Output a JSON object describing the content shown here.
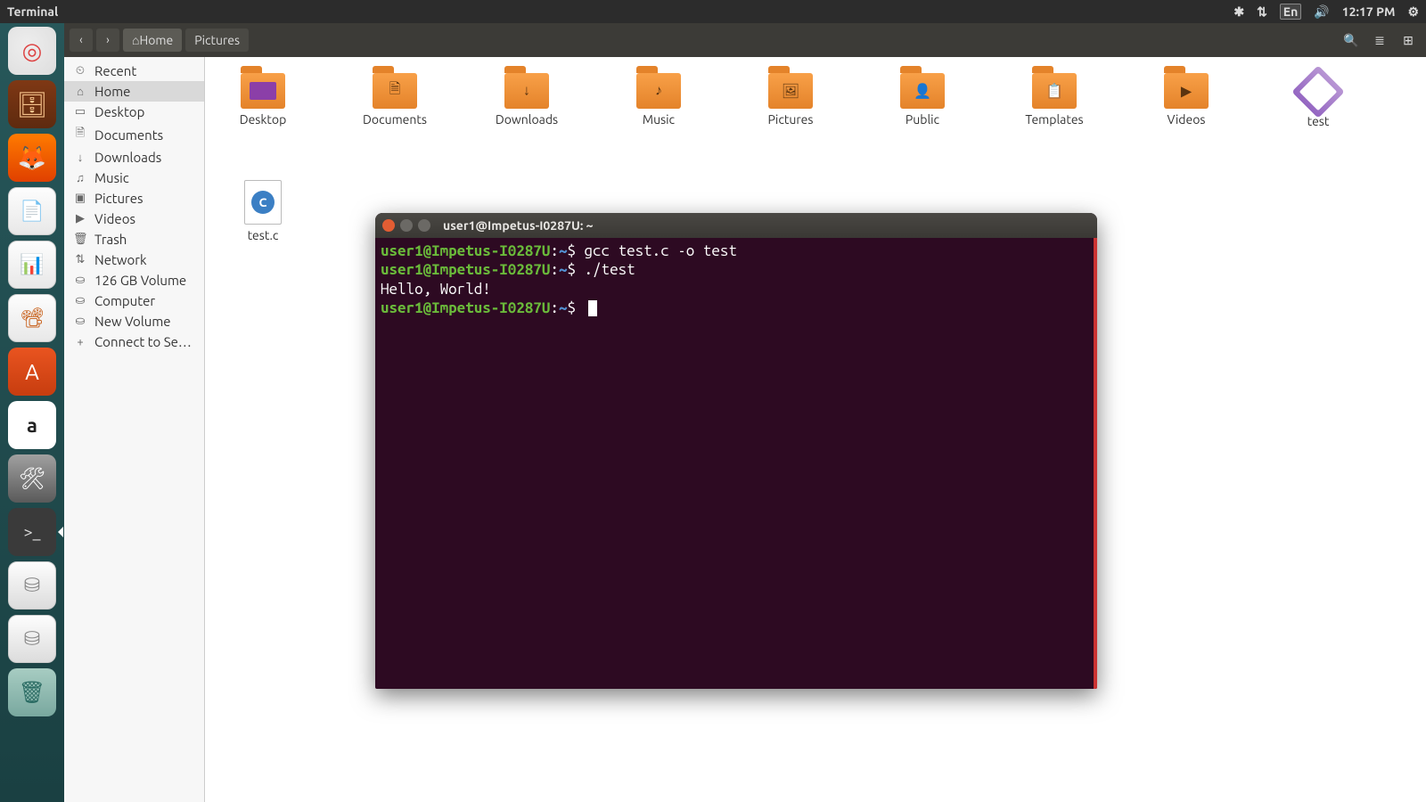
{
  "menubar": {
    "app_name": "Terminal",
    "lang_indicator": "En",
    "clock": "12:17 PM"
  },
  "launcher": [
    {
      "name": "dash",
      "tip": "Ubuntu Dash"
    },
    {
      "name": "files",
      "tip": "Files"
    },
    {
      "name": "firefox",
      "tip": "Firefox"
    },
    {
      "name": "writer",
      "tip": "LibreOffice Writer"
    },
    {
      "name": "calc",
      "tip": "LibreOffice Calc"
    },
    {
      "name": "impress",
      "tip": "LibreOffice Impress"
    },
    {
      "name": "software",
      "tip": "Ubuntu Software"
    },
    {
      "name": "amazon",
      "tip": "Amazon"
    },
    {
      "name": "settings",
      "tip": "System Settings"
    },
    {
      "name": "terminal",
      "tip": "Terminal"
    },
    {
      "name": "drive1",
      "tip": "Drive"
    },
    {
      "name": "drive2",
      "tip": "Drive"
    },
    {
      "name": "trash",
      "tip": "Trash"
    }
  ],
  "nautilus": {
    "path": [
      "Home",
      "Pictures"
    ],
    "sidebar": [
      {
        "icon": "⏲",
        "label": "Recent"
      },
      {
        "icon": "⌂",
        "label": "Home",
        "selected": true
      },
      {
        "icon": "▭",
        "label": "Desktop"
      },
      {
        "icon": "🗎",
        "label": "Documents"
      },
      {
        "icon": "↓",
        "label": "Downloads"
      },
      {
        "icon": "♫",
        "label": "Music"
      },
      {
        "icon": "▣",
        "label": "Pictures"
      },
      {
        "icon": "▶",
        "label": "Videos"
      },
      {
        "icon": "🗑",
        "label": "Trash"
      },
      {
        "icon": "⇅",
        "label": "Network"
      },
      {
        "icon": "⛀",
        "label": "126 GB Volume"
      },
      {
        "icon": "⛀",
        "label": "Computer"
      },
      {
        "icon": "⛀",
        "label": "New Volume"
      },
      {
        "icon": "+",
        "label": "Connect to Se…"
      }
    ],
    "files": [
      {
        "name": "Desktop",
        "type": "folder",
        "overlay": "desktop"
      },
      {
        "name": "Documents",
        "type": "folder",
        "overlay": "doc"
      },
      {
        "name": "Downloads",
        "type": "folder",
        "overlay": "down"
      },
      {
        "name": "Music",
        "type": "folder",
        "overlay": "music"
      },
      {
        "name": "Pictures",
        "type": "folder",
        "overlay": "pic"
      },
      {
        "name": "Public",
        "type": "folder",
        "overlay": "pub"
      },
      {
        "name": "Templates",
        "type": "folder",
        "overlay": "tmpl"
      },
      {
        "name": "Videos",
        "type": "folder",
        "overlay": "vid"
      },
      {
        "name": "test",
        "type": "exec"
      },
      {
        "name": "test.c",
        "type": "csrc"
      }
    ]
  },
  "terminal": {
    "title": "user1@Impetus-I0287U: ~",
    "prompt_user": "user1@Impetus-I0287U",
    "prompt_path": "~",
    "lines": [
      {
        "type": "cmd",
        "text": "gcc test.c -o test"
      },
      {
        "type": "cmd",
        "text": "./test"
      },
      {
        "type": "out",
        "text": "Hello, World!"
      },
      {
        "type": "cmd",
        "text": ""
      }
    ]
  }
}
